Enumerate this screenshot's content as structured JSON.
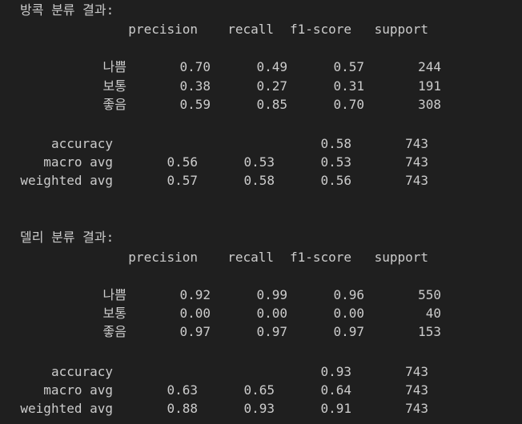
{
  "reports": [
    {
      "title": "방콕 분류 결과:",
      "headers": [
        "precision",
        "recall",
        "f1-score",
        "support"
      ],
      "classes": [
        {
          "label": "나쁨",
          "precision": "0.70",
          "recall": "0.49",
          "f1": "0.57",
          "support": "244"
        },
        {
          "label": "보통",
          "precision": "0.38",
          "recall": "0.27",
          "f1": "0.31",
          "support": "191"
        },
        {
          "label": "좋음",
          "precision": "0.59",
          "recall": "0.85",
          "f1": "0.70",
          "support": "308"
        }
      ],
      "accuracy": {
        "label": "accuracy",
        "f1": "0.58",
        "support": "743"
      },
      "macro": {
        "label": "macro avg",
        "precision": "0.56",
        "recall": "0.53",
        "f1": "0.53",
        "support": "743"
      },
      "weighted": {
        "label": "weighted avg",
        "precision": "0.57",
        "recall": "0.58",
        "f1": "0.56",
        "support": "743"
      }
    },
    {
      "title": "델리 분류 결과:",
      "headers": [
        "precision",
        "recall",
        "f1-score",
        "support"
      ],
      "classes": [
        {
          "label": "나쁨",
          "precision": "0.92",
          "recall": "0.99",
          "f1": "0.96",
          "support": "550"
        },
        {
          "label": "보통",
          "precision": "0.00",
          "recall": "0.00",
          "f1": "0.00",
          "support": "40"
        },
        {
          "label": "좋음",
          "precision": "0.97",
          "recall": "0.97",
          "f1": "0.97",
          "support": "153"
        }
      ],
      "accuracy": {
        "label": "accuracy",
        "f1": "0.93",
        "support": "743"
      },
      "macro": {
        "label": "macro avg",
        "precision": "0.63",
        "recall": "0.65",
        "f1": "0.64",
        "support": "743"
      },
      "weighted": {
        "label": "weighted avg",
        "precision": "0.88",
        "recall": "0.93",
        "f1": "0.91",
        "support": "743"
      }
    }
  ]
}
